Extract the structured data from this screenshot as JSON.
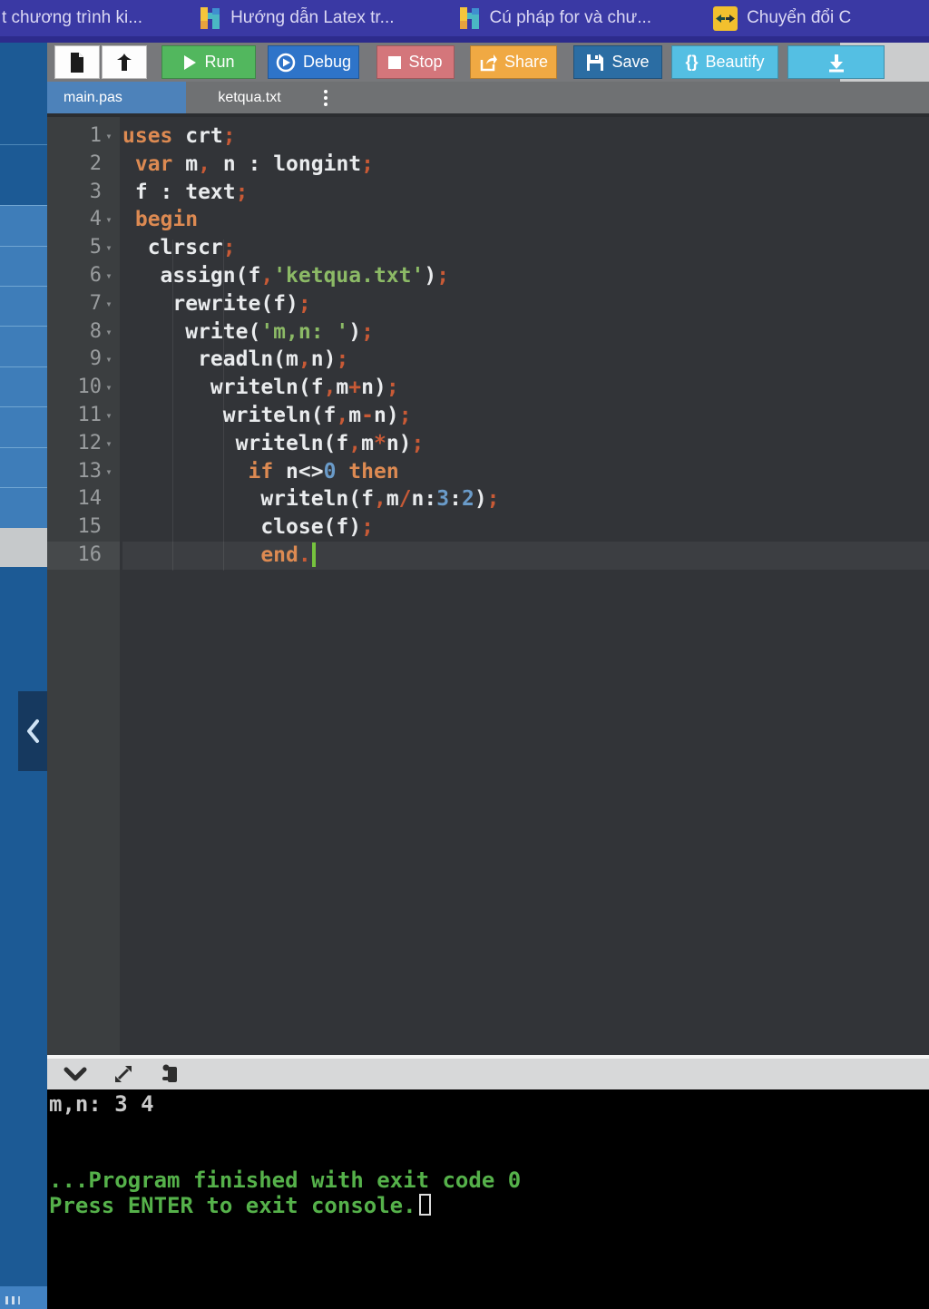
{
  "bookmarks": {
    "items": [
      {
        "label": "t chương trình ki...",
        "icon": "none"
      },
      {
        "label": "Hướng dẫn Latex tr...",
        "icon": "h-logo-icon"
      },
      {
        "label": "Cú pháp for và chư...",
        "icon": "h-logo-icon"
      },
      {
        "label": "Chuyển đổi C",
        "icon": "swap-arrows-icon"
      }
    ]
  },
  "toolbar": {
    "run_label": "Run",
    "debug_label": "Debug",
    "stop_label": "Stop",
    "share_label": "Share",
    "save_label": "Save",
    "beautify_label": "Beautify",
    "beautify_braces": "{}"
  },
  "tabs": [
    {
      "label": "main.pas",
      "active": true
    },
    {
      "label": "ketqua.txt",
      "active": false
    }
  ],
  "editor": {
    "active_line": 16,
    "cursor_line": 16,
    "lines": [
      {
        "num": 1,
        "fold": true,
        "tokens": [
          [
            "kw",
            "uses"
          ],
          [
            "pl",
            " crt"
          ],
          [
            "op",
            ";"
          ]
        ]
      },
      {
        "num": 2,
        "fold": false,
        "tokens": [
          [
            "pl",
            " "
          ],
          [
            "kw",
            "var"
          ],
          [
            "pl",
            " m"
          ],
          [
            "op",
            ","
          ],
          [
            "pl",
            " n : longint"
          ],
          [
            "op",
            ";"
          ]
        ]
      },
      {
        "num": 3,
        "fold": false,
        "tokens": [
          [
            "pl",
            " f : text"
          ],
          [
            "op",
            ";"
          ]
        ]
      },
      {
        "num": 4,
        "fold": true,
        "tokens": [
          [
            "pl",
            " "
          ],
          [
            "kw",
            "begin"
          ]
        ]
      },
      {
        "num": 5,
        "fold": true,
        "tokens": [
          [
            "pl",
            "  clrscr"
          ],
          [
            "op",
            ";"
          ]
        ]
      },
      {
        "num": 6,
        "fold": true,
        "tokens": [
          [
            "pl",
            "   assign(f"
          ],
          [
            "op",
            ","
          ],
          [
            "str",
            "'ketqua.txt'"
          ],
          [
            "pl",
            ")"
          ],
          [
            "op",
            ";"
          ]
        ]
      },
      {
        "num": 7,
        "fold": true,
        "tokens": [
          [
            "pl",
            "    rewrite(f)"
          ],
          [
            "op",
            ";"
          ]
        ]
      },
      {
        "num": 8,
        "fold": true,
        "tokens": [
          [
            "pl",
            "     write("
          ],
          [
            "str",
            "'m,n: '"
          ],
          [
            "pl",
            ")"
          ],
          [
            "op",
            ";"
          ]
        ]
      },
      {
        "num": 9,
        "fold": true,
        "tokens": [
          [
            "pl",
            "      readln(m"
          ],
          [
            "op",
            ","
          ],
          [
            "pl",
            "n)"
          ],
          [
            "op",
            ";"
          ]
        ]
      },
      {
        "num": 10,
        "fold": true,
        "tokens": [
          [
            "pl",
            "       writeln(f"
          ],
          [
            "op",
            ","
          ],
          [
            "pl",
            "m"
          ],
          [
            "op",
            "+"
          ],
          [
            "pl",
            "n)"
          ],
          [
            "op",
            ";"
          ]
        ]
      },
      {
        "num": 11,
        "fold": true,
        "tokens": [
          [
            "pl",
            "        writeln(f"
          ],
          [
            "op",
            ","
          ],
          [
            "pl",
            "m"
          ],
          [
            "op",
            "-"
          ],
          [
            "pl",
            "n)"
          ],
          [
            "op",
            ";"
          ]
        ]
      },
      {
        "num": 12,
        "fold": true,
        "tokens": [
          [
            "pl",
            "         writeln(f"
          ],
          [
            "op",
            ","
          ],
          [
            "pl",
            "m"
          ],
          [
            "op",
            "*"
          ],
          [
            "pl",
            "n)"
          ],
          [
            "op",
            ";"
          ]
        ]
      },
      {
        "num": 13,
        "fold": true,
        "tokens": [
          [
            "pl",
            "          "
          ],
          [
            "kw",
            "if"
          ],
          [
            "pl",
            " n<>"
          ],
          [
            "num",
            "0"
          ],
          [
            "pl",
            " "
          ],
          [
            "kw",
            "then"
          ]
        ]
      },
      {
        "num": 14,
        "fold": false,
        "tokens": [
          [
            "pl",
            "           writeln(f"
          ],
          [
            "op",
            ","
          ],
          [
            "pl",
            "m"
          ],
          [
            "op",
            "/"
          ],
          [
            "pl",
            "n:"
          ],
          [
            "num",
            "3"
          ],
          [
            "pl",
            ":"
          ],
          [
            "num",
            "2"
          ],
          [
            "pl",
            ")"
          ],
          [
            "op",
            ";"
          ]
        ]
      },
      {
        "num": 15,
        "fold": false,
        "tokens": [
          [
            "pl",
            "           close(f)"
          ],
          [
            "op",
            ";"
          ]
        ]
      },
      {
        "num": 16,
        "fold": false,
        "tokens": [
          [
            "pl",
            "           "
          ],
          [
            "kw",
            "end"
          ],
          [
            "op",
            "."
          ]
        ]
      }
    ]
  },
  "console": {
    "lines": [
      {
        "kind": "output",
        "text": "m,n: 3 4",
        "cursor": false
      },
      {
        "kind": "output",
        "text": "",
        "cursor": false
      },
      {
        "kind": "output",
        "text": "",
        "cursor": false
      },
      {
        "kind": "status",
        "text": "...Program finished with exit code 0",
        "cursor": false
      },
      {
        "kind": "status",
        "text": "Press ENTER to exit console.",
        "cursor": true
      }
    ]
  },
  "colors": {
    "bookmarks_bar_bg": "#3a39a4",
    "run_green": "#52b75e",
    "debug_blue": "#2e74c9",
    "stop_red": "#d4767b",
    "share_orange": "#f0a943",
    "save_blue": "#2b6da3",
    "beautify_cyan": "#54bfe3",
    "active_tab_blue": "#4d82ba",
    "editor_bg": "#323438",
    "keyword_orange": "#dd8a52",
    "operator_red": "#c85a36",
    "string_green": "#8cba66",
    "number_blue": "#6a9bc9",
    "console_status_green": "#55b14a",
    "cursor_green": "#76c33e",
    "sidebar_dark_blue": "#1c5a95",
    "sidebar_light_blue": "#3e7db9"
  }
}
